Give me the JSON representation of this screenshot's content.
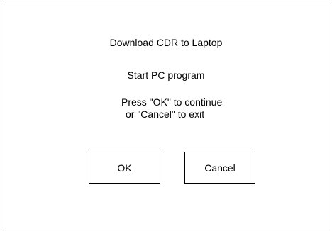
{
  "dialog": {
    "title": "Download CDR to Laptop",
    "subtitle": "Start PC program",
    "instructions": [
      "Press \"OK\" to continue",
      "or \"Cancel\" to exit"
    ],
    "ok_label": "OK",
    "cancel_label": "Cancel"
  }
}
